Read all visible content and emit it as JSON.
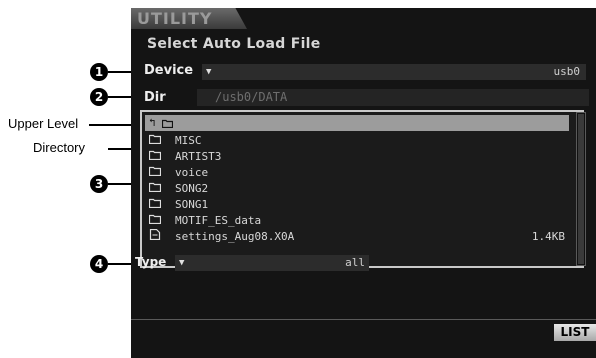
{
  "tab": {
    "label": "UTILITY"
  },
  "page": {
    "heading": "Select Auto Load File"
  },
  "device": {
    "label": "Device",
    "value": "usb0"
  },
  "dir": {
    "label": "Dir",
    "path": "/usb0/DATA"
  },
  "file_list": {
    "items": [
      {
        "name": "",
        "type": "upper-level",
        "icon": "up-arrow-folder-icon",
        "size": ""
      },
      {
        "name": "MISC",
        "type": "directory",
        "icon": "folder-icon",
        "size": ""
      },
      {
        "name": "ARTIST3",
        "type": "directory",
        "icon": "folder-icon",
        "size": ""
      },
      {
        "name": "voice",
        "type": "directory",
        "icon": "folder-icon",
        "size": ""
      },
      {
        "name": "SONG2",
        "type": "directory",
        "icon": "folder-icon",
        "size": ""
      },
      {
        "name": "SONG1",
        "type": "directory",
        "icon": "folder-icon",
        "size": ""
      },
      {
        "name": "MOTIF_ES_data",
        "type": "directory",
        "icon": "folder-icon",
        "size": ""
      },
      {
        "name": "settings_Aug08.X0A",
        "type": "file",
        "icon": "file-icon",
        "size": "1.4KB"
      }
    ],
    "selected_index": 0
  },
  "type_field": {
    "label": "Type",
    "value": "all"
  },
  "footer": {
    "list_button": "LIST"
  },
  "callouts": {
    "c1": "1",
    "c2": "2",
    "c3": "3",
    "c4": "4"
  },
  "annotations": {
    "upper_level": "Upper Level",
    "directory": "Directory"
  },
  "colors": {
    "screen_bg": "#141414",
    "selected_row": "#9c9c9c",
    "button_bg": "#d0d0d0"
  }
}
